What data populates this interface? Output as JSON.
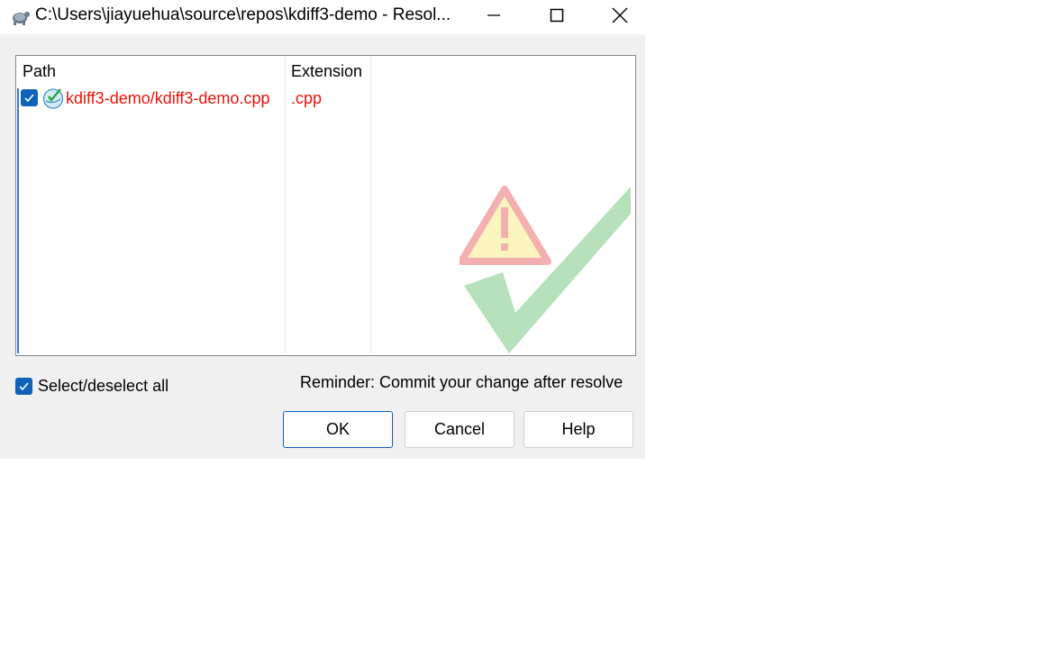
{
  "window": {
    "title": "C:\\Users\\jiayuehua\\source\\repos\\kdiff3-demo - Resol...",
    "app_icon": "tortoise-icon",
    "controls": {
      "minimize_icon": "minimize-icon",
      "maximize_icon": "maximize-icon",
      "close_icon": "close-icon"
    }
  },
  "list": {
    "columns": [
      "Path",
      "Extension"
    ],
    "rows": [
      {
        "checked": true,
        "icon": "conflict-file-icon",
        "path": "kdiff3-demo/kdiff3-demo.cpp",
        "extension": ".cpp",
        "text_color": "#e8130a"
      }
    ],
    "watermark_icon": "warning-checkmark-watermark"
  },
  "select_all": {
    "label": "Select/deselect all",
    "checked": true
  },
  "reminder": "Reminder: Commit your change after resolve",
  "buttons": {
    "ok": "OK",
    "cancel": "Cancel",
    "help": "Help"
  },
  "colors": {
    "accent": "#0f62b8",
    "conflict_text": "#e8130a",
    "dialog_bg": "#f0f0f0"
  }
}
